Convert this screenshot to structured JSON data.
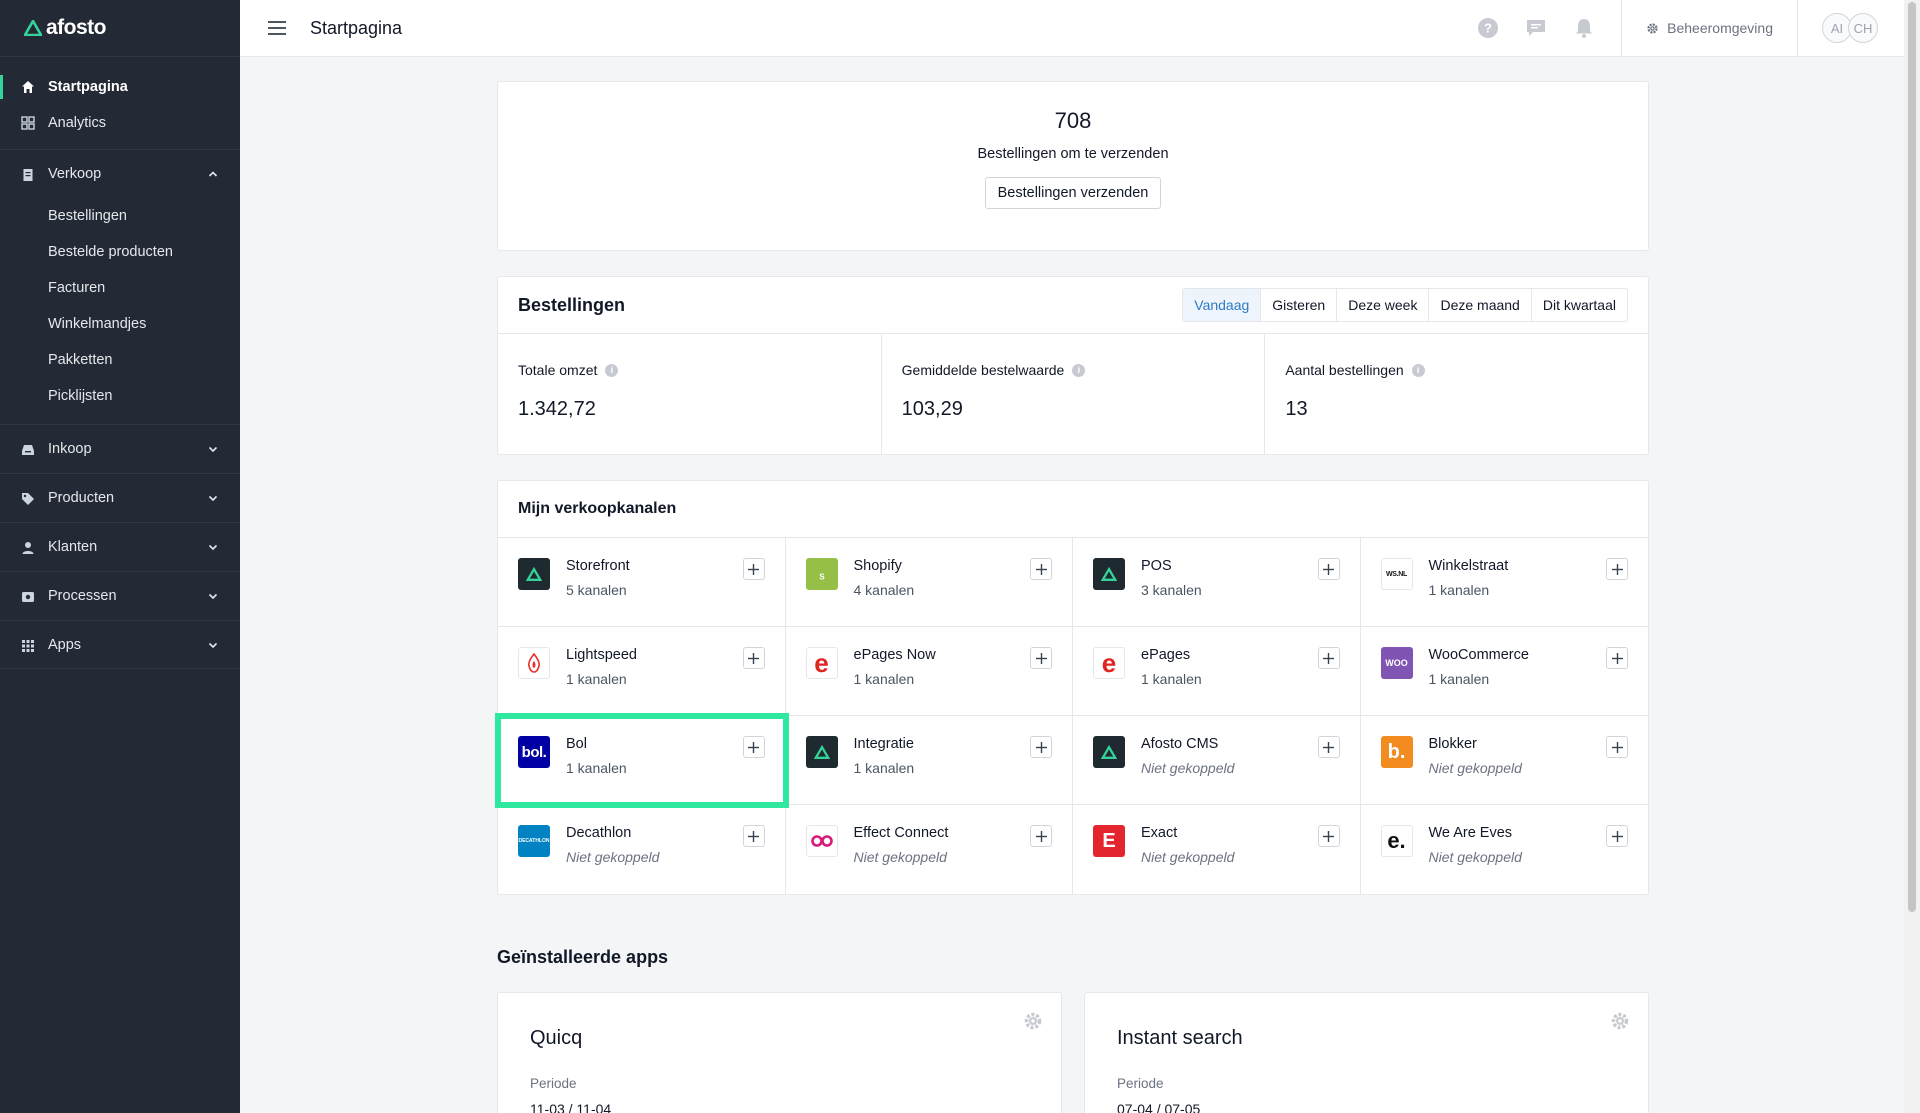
{
  "brand": {
    "name": "afosto"
  },
  "sidebar": {
    "top_items": [
      {
        "label": "Startpagina",
        "icon": "home-icon"
      },
      {
        "label": "Analytics",
        "icon": "analytics-icon"
      }
    ],
    "verkoop": {
      "label": "Verkoop",
      "items": [
        "Bestellingen",
        "Bestelde producten",
        "Facturen",
        "Winkelmandjes",
        "Pakketten",
        "Picklijsten"
      ]
    },
    "groups": [
      {
        "label": "Inkoop",
        "icon": "inbox-icon"
      },
      {
        "label": "Producten",
        "icon": "tag-icon"
      },
      {
        "label": "Klanten",
        "icon": "user-icon"
      },
      {
        "label": "Processen",
        "icon": "process-icon"
      },
      {
        "label": "Apps",
        "icon": "grid-icon"
      }
    ]
  },
  "topbar": {
    "title": "Startpagina",
    "environment": "Beheeromgeving",
    "avatars": [
      "AI",
      "CH"
    ]
  },
  "hero": {
    "count": "708",
    "label": "Bestellingen om te verzenden",
    "button": "Bestellingen verzenden"
  },
  "orders": {
    "title": "Bestellingen",
    "tabs": [
      "Vandaag",
      "Gisteren",
      "Deze week",
      "Deze maand",
      "Dit kwartaal"
    ],
    "active_tab": "Vandaag",
    "stats": [
      {
        "label": "Totale omzet",
        "value": "1.342,72"
      },
      {
        "label": "Gemiddelde bestelwaarde",
        "value": "103,29"
      },
      {
        "label": "Aantal bestellingen",
        "value": "13"
      }
    ]
  },
  "channels": {
    "title": "Mijn verkoopkanalen",
    "items": [
      {
        "name": "Storefront",
        "sub": "5 kanalen",
        "icon": "afosto-icon",
        "color": "#1f2a30"
      },
      {
        "name": "Shopify",
        "sub": "4 kanalen",
        "icon": "shopify-icon",
        "color": "#95bf47"
      },
      {
        "name": "POS",
        "sub": "3 kanalen",
        "icon": "afosto-icon",
        "color": "#1f2a30"
      },
      {
        "name": "Winkelstraat",
        "sub": "1 kanalen",
        "icon": "winkelstraat-icon",
        "color": "#ffffff"
      },
      {
        "name": "Lightspeed",
        "sub": "1 kanalen",
        "icon": "lightspeed-icon",
        "color": "#ffffff"
      },
      {
        "name": "ePages Now",
        "sub": "1 kanalen",
        "icon": "epages-icon",
        "color": "#ffffff"
      },
      {
        "name": "ePages",
        "sub": "1 kanalen",
        "icon": "epages-icon",
        "color": "#ffffff"
      },
      {
        "name": "WooCommerce",
        "sub": "1 kanalen",
        "icon": "woocommerce-icon",
        "color": "#7f54b3"
      },
      {
        "name": "Bol",
        "sub": "1 kanalen",
        "icon": "bol-icon",
        "color": "#0000a4"
      },
      {
        "name": "Integratie",
        "sub": "1 kanalen",
        "icon": "afosto-icon",
        "color": "#1f2a30"
      },
      {
        "name": "Afosto CMS",
        "sub": "Niet gekoppeld",
        "icon": "afosto-icon",
        "color": "#1f2a30"
      },
      {
        "name": "Blokker",
        "sub": "Niet gekoppeld",
        "icon": "blokker-icon",
        "color": "#f28b20"
      },
      {
        "name": "Decathlon",
        "sub": "Niet gekoppeld",
        "icon": "decathlon-icon",
        "color": "#0082c3"
      },
      {
        "name": "Effect Connect",
        "sub": "Niet gekoppeld",
        "icon": "effect-connect-icon",
        "color": "#ffffff"
      },
      {
        "name": "Exact",
        "sub": "Niet gekoppeld",
        "icon": "exact-icon",
        "color": "#e3262e"
      },
      {
        "name": "We Are Eves",
        "sub": "Niet gekoppeld",
        "icon": "we-are-eves-icon",
        "color": "#ffffff"
      }
    ]
  },
  "apps": {
    "title": "Geïnstalleerde apps",
    "items": [
      {
        "name": "Quicq",
        "period_label": "Periode",
        "period": "11-03 / 11-04"
      },
      {
        "name": "Instant search",
        "period_label": "Periode",
        "period": "07-04 / 07-05"
      }
    ]
  }
}
